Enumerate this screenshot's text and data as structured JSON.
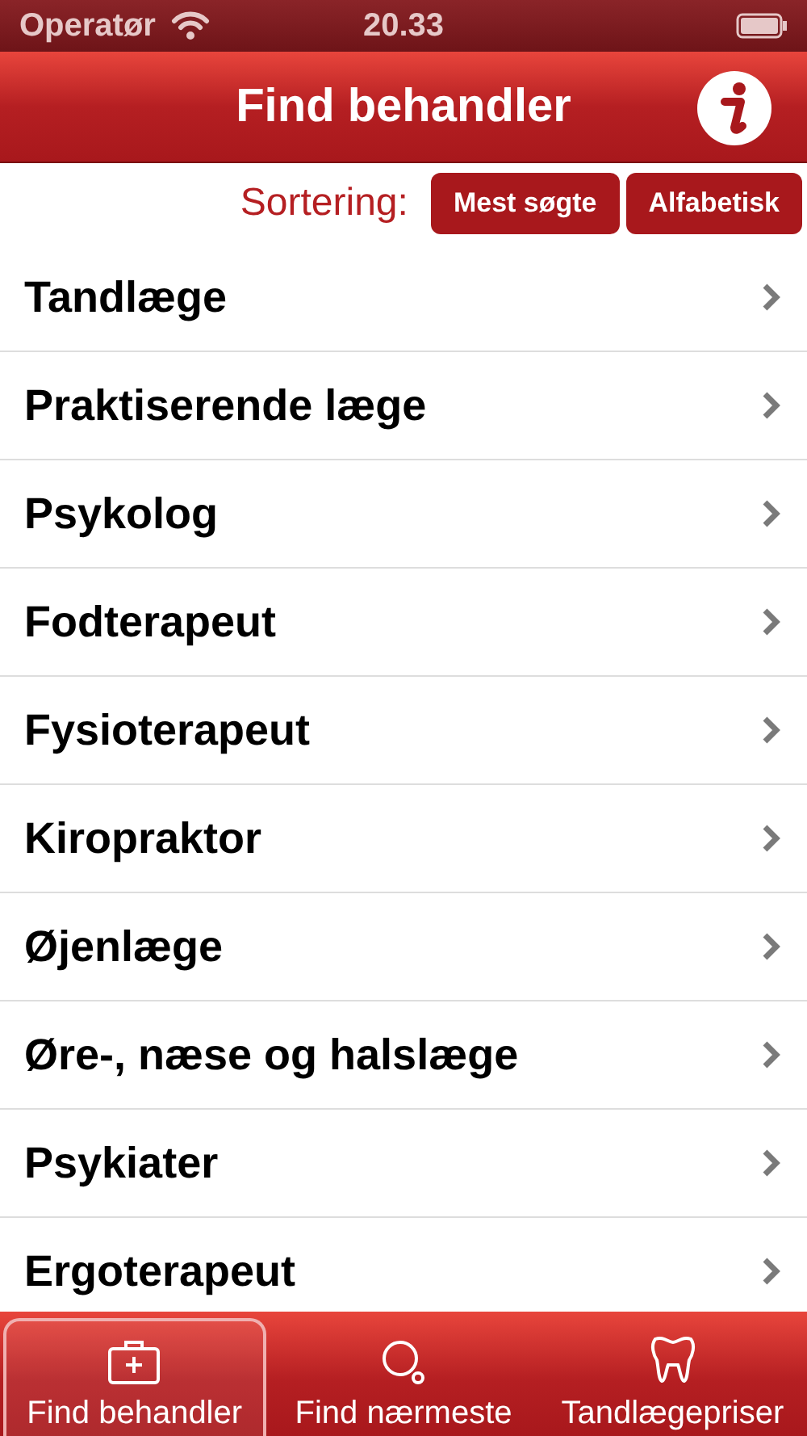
{
  "status_bar": {
    "carrier": "Operatør",
    "time": "20.33"
  },
  "nav_bar": {
    "title": "Find behandler"
  },
  "sorting": {
    "label": "Sortering:",
    "options": [
      {
        "label": "Mest søgte",
        "selected": false
      },
      {
        "label": "Alfabetisk",
        "selected": false
      }
    ]
  },
  "list": {
    "items": [
      {
        "label": "Tandlæge"
      },
      {
        "label": "Praktiserende læge"
      },
      {
        "label": "Psykolog"
      },
      {
        "label": "Fodterapeut"
      },
      {
        "label": "Fysioterapeut"
      },
      {
        "label": "Kiropraktor"
      },
      {
        "label": "Øjenlæge"
      },
      {
        "label": "Øre-, næse og halslæge"
      },
      {
        "label": "Psykiater"
      },
      {
        "label": "Ergoterapeut"
      }
    ]
  },
  "tab_bar": {
    "tabs": [
      {
        "label": "Find behandler",
        "kind": "medkit",
        "selected": true
      },
      {
        "label": "Find nærmeste",
        "kind": "search",
        "selected": false
      },
      {
        "label": "Tandlægepriser",
        "kind": "tooth",
        "selected": false
      }
    ]
  }
}
